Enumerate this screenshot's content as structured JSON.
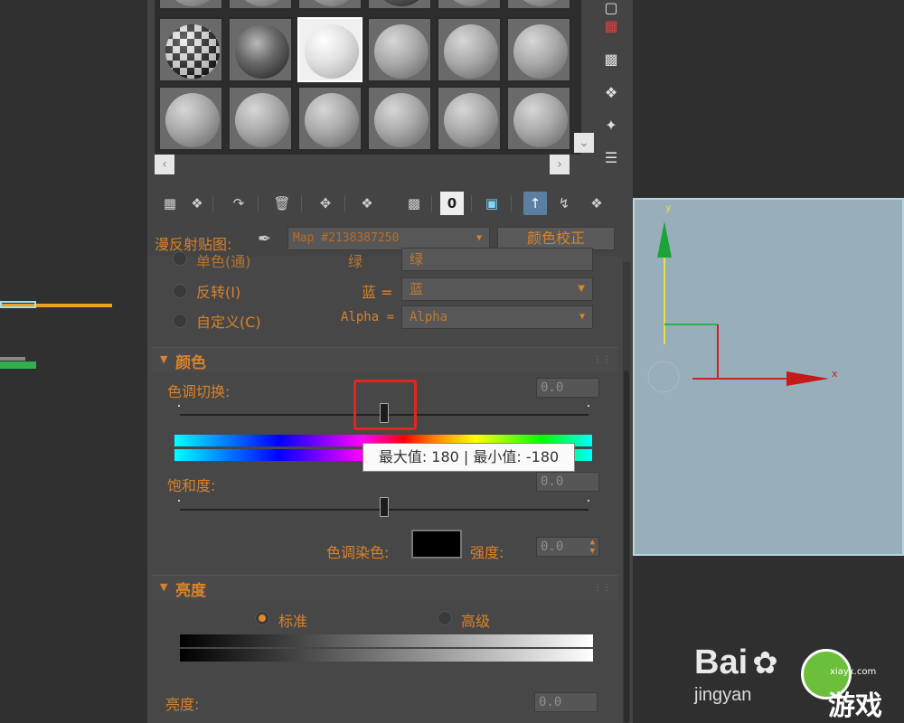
{
  "material_editor": {
    "diffuse_map_label": "漫反射贴图:",
    "map_name": "Map #2138387250",
    "color_correction_button": "颜色校正",
    "channels": {
      "single_color_label": "单色(通)",
      "green_label": "绿",
      "green_value": "绿",
      "invert_label": "反转(I)",
      "blue_label": "蓝 =",
      "blue_value": "蓝",
      "custom_label": "自定义(C)",
      "alpha_label": "Alpha =",
      "alpha_value": "Alpha"
    },
    "color_rollout": {
      "title": "颜色",
      "hue_shift_label": "色调切换:",
      "hue_shift_value": "0.0",
      "tooltip": "最大值: 180 | 最小值: -180",
      "saturation_label": "饱和度:",
      "saturation_value": "0.0",
      "tint_label": "色调染色:",
      "strength_label": "强度:",
      "strength_value": "0.0"
    },
    "lightness_rollout": {
      "title": "亮度",
      "standard_label": "标准",
      "advanced_label": "高级",
      "brightness_label": "亮度:",
      "brightness_value": "0.0"
    }
  },
  "viewport": {
    "y_axis_label": "y",
    "x_axis_label": "x"
  },
  "watermark": {
    "brand": "Bai",
    "sub": "jingyan",
    "site": "xiayx.com",
    "game_text": "游戏"
  },
  "colors": {
    "accent_orange": "#d9822b",
    "tooltip_highlight": "#e0271e",
    "viewport_bg": "#98aebb"
  }
}
